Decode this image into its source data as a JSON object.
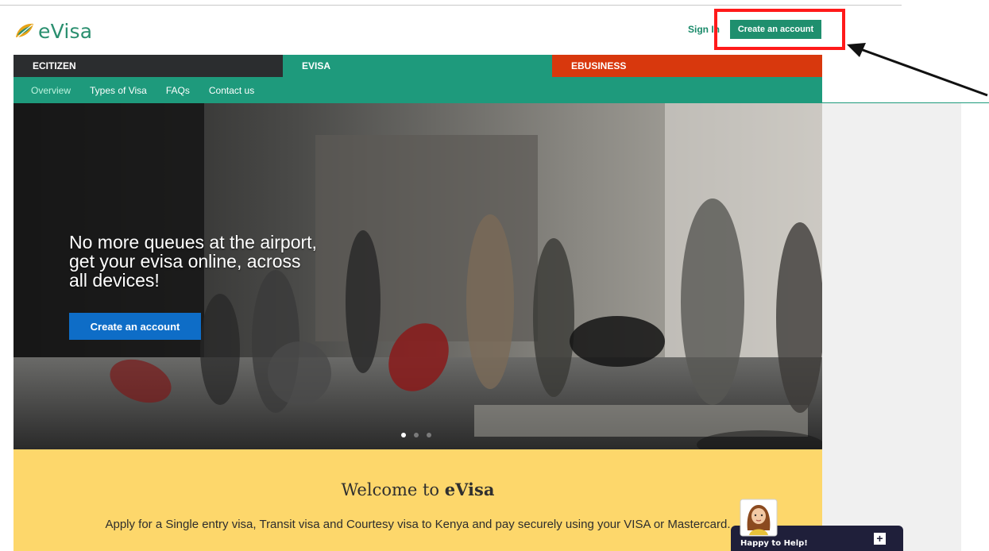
{
  "header": {
    "logo_text": "eVisa",
    "sign_in": "Sign In",
    "create_account": "Create an account"
  },
  "tabs": [
    {
      "label": "ECITIZEN",
      "color": "#2b2d2f"
    },
    {
      "label": "EVISA",
      "color": "#1e9a7c"
    },
    {
      "label": "EBUSINESS",
      "color": "#d8380d"
    }
  ],
  "subnav": [
    "Overview",
    "Types of Visa",
    "FAQs",
    "Contact us"
  ],
  "hero": {
    "headline": "No more queues at the airport, get your evisa online, across all devices!",
    "button": "Create an account",
    "slide_count": 3,
    "active_slide": 1
  },
  "welcome": {
    "title_prefix": "Welcome to ",
    "title_brand": "eVisa",
    "body": "Apply for a Single entry visa, Transit visa and Courtesy visa to Kenya and pay securely using your VISA or Mastercard."
  },
  "help_widget": {
    "label": "Happy to Help!",
    "plus": "+"
  },
  "icons": {
    "logo": "leaf-logo-icon",
    "help_avatar": "support-agent-avatar",
    "expand": "plus-icon",
    "annotation": "arrow-annotation"
  },
  "colors": {
    "brand_green": "#1e9a7c",
    "ebusiness_orange": "#d8380d",
    "hero_button_blue": "#0e6dc7",
    "welcome_yellow": "#fdd76b",
    "highlight_red": "#ff1a1a"
  }
}
